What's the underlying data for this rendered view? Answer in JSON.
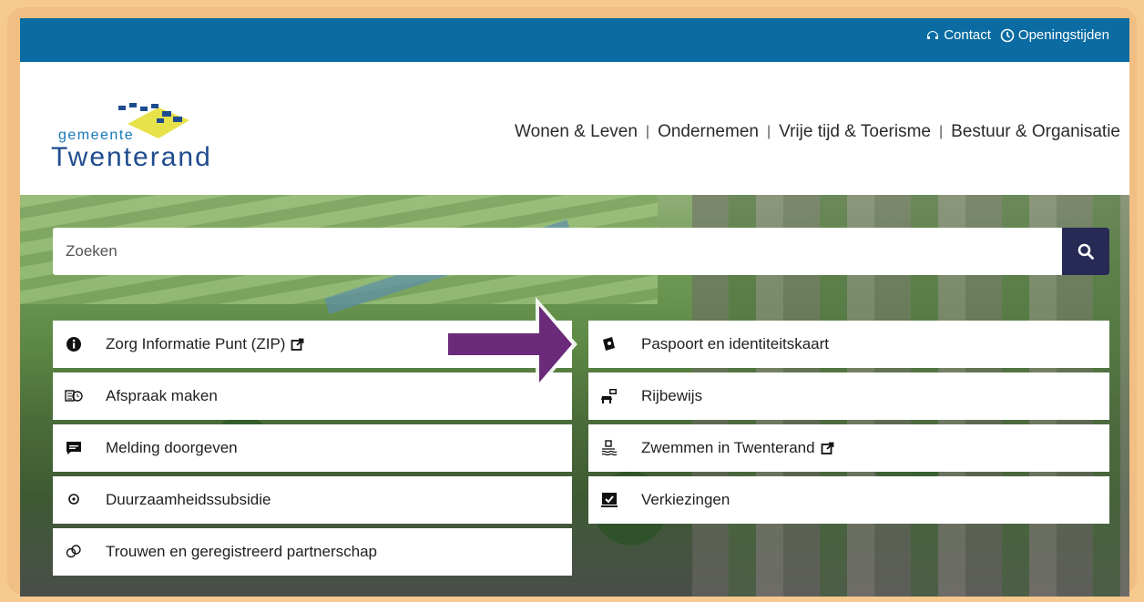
{
  "topbar": {
    "contact": "Contact",
    "openingstijden": "Openingstijden"
  },
  "logo": {
    "gemeente": "gemeente",
    "name": "Twenterand"
  },
  "nav": {
    "items": [
      "Wonen & Leven",
      "Ondernemen",
      "Vrije tijd & Toerisme",
      "Bestuur & Organisatie"
    ],
    "separator": "|"
  },
  "search": {
    "placeholder": "Zoeken"
  },
  "tiles": {
    "left": [
      {
        "label": "Zorg Informatie Punt (ZIP)",
        "icon": "info-icon",
        "external": true
      },
      {
        "label": "Afspraak maken",
        "icon": "calendar-clock-icon",
        "external": false
      },
      {
        "label": "Melding doorgeven",
        "icon": "chat-icon",
        "external": false
      },
      {
        "label": "Duurzaamheidssubsidie",
        "icon": "sustainability-icon",
        "external": false
      },
      {
        "label": "Trouwen en geregistreerd partnerschap",
        "icon": "rings-icon",
        "external": false
      }
    ],
    "right": [
      {
        "label": "Paspoort en identiteitskaart",
        "icon": "passport-icon",
        "external": false
      },
      {
        "label": "Rijbewijs",
        "icon": "car-license-icon",
        "external": false
      },
      {
        "label": "Zwemmen in Twenterand",
        "icon": "swimming-icon",
        "external": true
      },
      {
        "label": "Verkiezingen",
        "icon": "ballot-icon",
        "external": false
      }
    ]
  },
  "colors": {
    "topbar": "#0a6ca2",
    "search_button": "#262a55",
    "arrow": "#6b2a7a",
    "frame": "#f1be84"
  }
}
